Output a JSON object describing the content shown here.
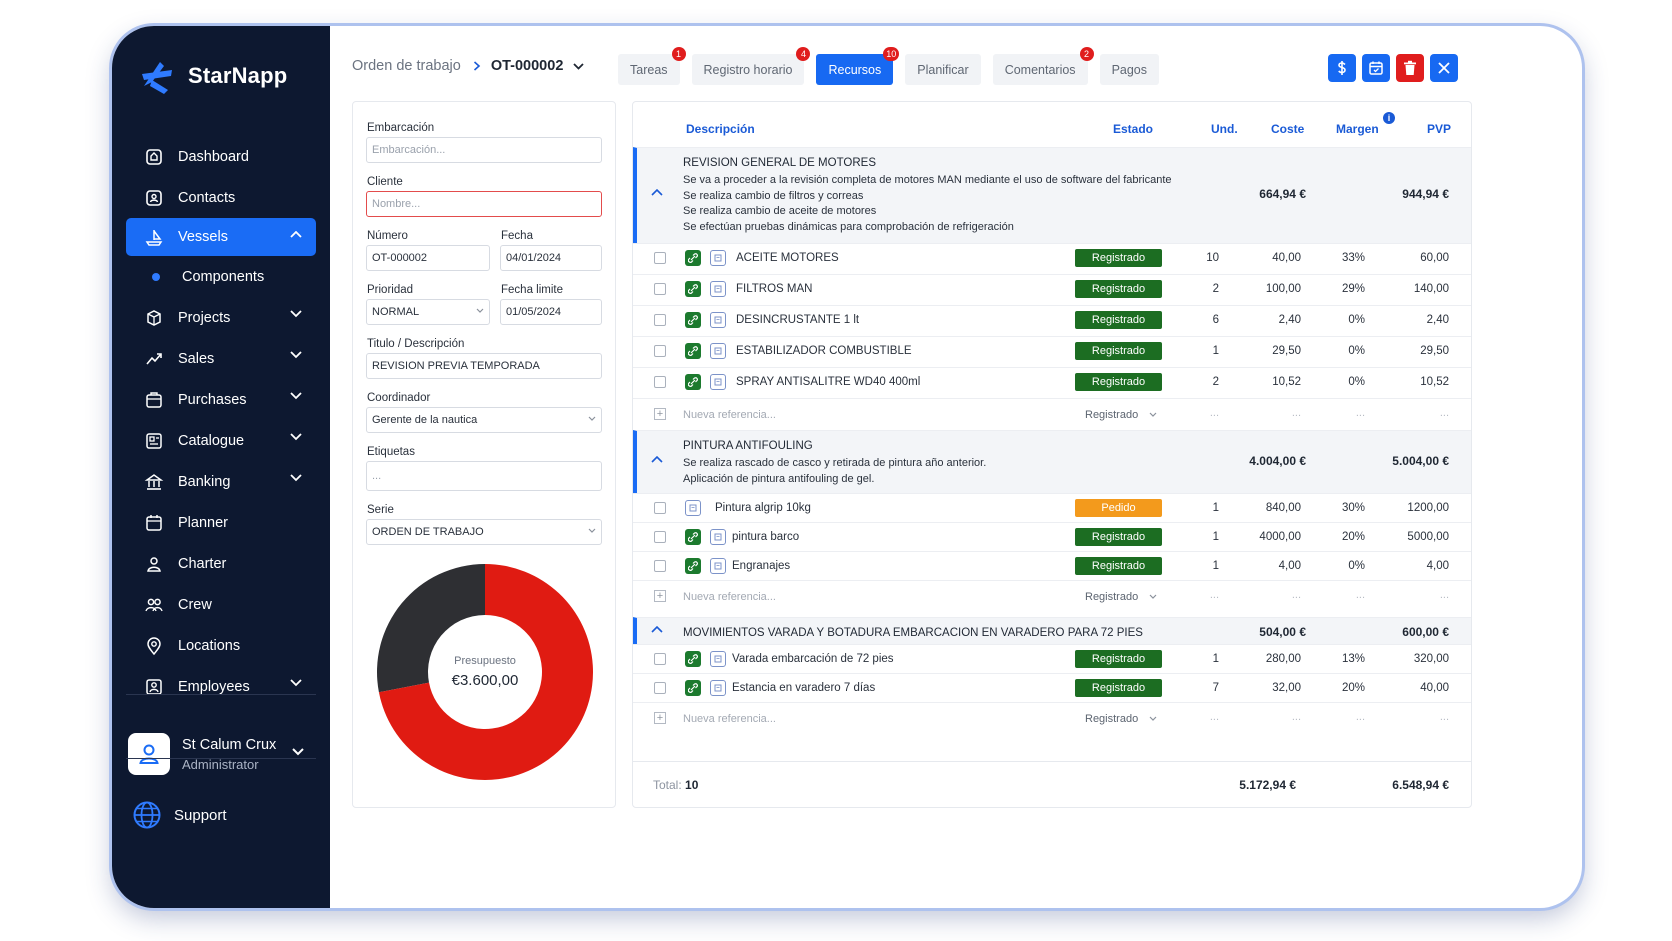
{
  "app": {
    "name": "StarNapp"
  },
  "sidebar": {
    "items": [
      {
        "label": "Dashboard",
        "icon": "dashboard-icon",
        "chevron": false
      },
      {
        "label": "Contacts",
        "icon": "contacts-icon",
        "chevron": false
      },
      {
        "label": "Vessels",
        "icon": "vessels-icon",
        "chevron": true,
        "active": true,
        "expanded": true
      },
      {
        "label": "Components",
        "icon": "dot-icon",
        "sub": true
      },
      {
        "label": "Projects",
        "icon": "projects-icon",
        "chevron": true
      },
      {
        "label": "Sales",
        "icon": "sales-icon",
        "chevron": true
      },
      {
        "label": "Purchases",
        "icon": "purchases-icon",
        "chevron": true
      },
      {
        "label": "Catalogue",
        "icon": "catalogue-icon",
        "chevron": true
      },
      {
        "label": "Banking",
        "icon": "banking-icon",
        "chevron": true
      },
      {
        "label": "Planner",
        "icon": "planner-icon",
        "chevron": false
      },
      {
        "label": "Charter",
        "icon": "charter-icon",
        "chevron": false
      },
      {
        "label": "Crew",
        "icon": "crew-icon",
        "chevron": false
      },
      {
        "label": "Locations",
        "icon": "locations-icon",
        "chevron": false
      },
      {
        "label": "Employees",
        "icon": "employees-icon",
        "chevron": true
      }
    ],
    "user": {
      "name": "St Calum Crux",
      "role": "Administrator"
    },
    "support": "Support"
  },
  "header": {
    "breadcrumb_root": "Orden de trabajo",
    "breadcrumb_current": "OT-000002",
    "tabs": [
      {
        "label": "Tareas",
        "badge": "1"
      },
      {
        "label": "Registro horario",
        "badge": "4"
      },
      {
        "label": "Recursos",
        "badge": "10",
        "active": true
      },
      {
        "label": "Planificar",
        "badge": ""
      },
      {
        "label": "Comentarios",
        "badge": "2"
      },
      {
        "label": "Pagos",
        "badge": ""
      }
    ],
    "colors": {
      "accent": "#1769f2",
      "danger": "#e01d1d"
    }
  },
  "form": {
    "embarcacion_label": "Embarcación",
    "embarcacion_placeholder": "Embarcación...",
    "cliente_label": "Cliente",
    "cliente_placeholder": "Nombre...",
    "numero_label": "Número",
    "numero_value": "OT-000002",
    "fecha_label": "Fecha",
    "fecha_value": "04/01/2024",
    "prioridad_label": "Prioridad",
    "prioridad_value": "NORMAL",
    "fecha_limite_label": "Fecha limite",
    "fecha_limite_value": "01/05/2024",
    "titulo_label": "Titulo / Descripción",
    "titulo_value": "REVISION PREVIA TEMPORADA",
    "coordinador_label": "Coordinador",
    "coordinador_value": "Gerente de la nautica",
    "etiquetas_label": "Etiquetas",
    "etiquetas_placeholder": "...",
    "serie_label": "Serie",
    "serie_value": "ORDEN DE TRABAJO",
    "budget_label": "Presupuesto",
    "budget_value": "€3.600,00",
    "budget_share": 0.72,
    "budget_colors": {
      "main": "#e01b12",
      "rest": "#2e2f33"
    }
  },
  "table": {
    "headers": {
      "descripcion": "Descripción",
      "estado": "Estado",
      "und": "Und.",
      "coste": "Coste",
      "margen": "Margen",
      "pvp": "PVP"
    },
    "new_ref_placeholder": "Nueva referencia...",
    "new_ref_status": "Registrado",
    "empty": "...",
    "groups": [
      {
        "title": "REVISION GENERAL DE MOTORES",
        "desc": [
          "Se va a proceder a la revisión completa de motores MAN mediante el uso de software del fabricante",
          "Se realiza cambio de filtros y correas",
          "Se realiza cambio de aceite de motores",
          "Se efectúan pruebas dinámicas para comprobación de refrigeración"
        ],
        "coste": "664,94 €",
        "pvp": "944,94 €",
        "items": [
          {
            "name": "ACEITE MOTORES",
            "status": "Registrado",
            "und": "10",
            "coste": "40,00",
            "margen": "33%",
            "pvp": "60,00",
            "green": true
          },
          {
            "name": "FILTROS MAN",
            "status": "Registrado",
            "und": "2",
            "coste": "100,00",
            "margen": "29%",
            "pvp": "140,00",
            "green": true
          },
          {
            "name": "DESINCRUSTANTE 1 lt",
            "status": "Registrado",
            "und": "6",
            "coste": "2,40",
            "margen": "0%",
            "pvp": "2,40",
            "green": true
          },
          {
            "name": "ESTABILIZADOR COMBUSTIBLE",
            "status": "Registrado",
            "und": "1",
            "coste": "29,50",
            "margen": "0%",
            "pvp": "29,50",
            "green": true
          },
          {
            "name": "SPRAY ANTISALITRE WD40 400ml",
            "status": "Registrado",
            "und": "2",
            "coste": "10,52",
            "margen": "0%",
            "pvp": "10,52",
            "green": true
          }
        ]
      },
      {
        "title": "PINTURA ANTIFOULING",
        "desc": [
          "Se realiza rascado de casco y retirada de pintura año anterior.",
          "Aplicación de pintura antifouling de gel."
        ],
        "coste": "4.004,00 €",
        "pvp": "5.004,00 €",
        "items": [
          {
            "name": "Pintura algrip 10kg",
            "status": "Pedido",
            "und": "1",
            "coste": "840,00",
            "margen": "30%",
            "pvp": "1200,00",
            "green": false
          },
          {
            "name": "pintura barco",
            "status": "Registrado",
            "und": "1",
            "coste": "4000,00",
            "margen": "20%",
            "pvp": "5000,00",
            "green": true
          },
          {
            "name": "Engranajes",
            "status": "Registrado",
            "und": "1",
            "coste": "4,00",
            "margen": "0%",
            "pvp": "4,00",
            "green": true
          }
        ]
      },
      {
        "title": "MOVIMIENTOS VARADA Y BOTADURA EMBARCACION EN VARADERO PARA 72 PIES",
        "desc": [],
        "coste": "504,00 €",
        "pvp": "600,00 €",
        "items": [
          {
            "name": "Varada embarcación de 72 pies",
            "status": "Registrado",
            "und": "1",
            "coste": "280,00",
            "margen": "13%",
            "pvp": "320,00",
            "green": true
          },
          {
            "name": "Estancia en varadero 7 días",
            "status": "Registrado",
            "und": "7",
            "coste": "32,00",
            "margen": "20%",
            "pvp": "40,00",
            "green": true
          }
        ]
      }
    ],
    "total_label": "Total:",
    "total_count": "10",
    "total_coste": "5.172,94 €",
    "total_pvp": "6.548,94 €",
    "colors": {
      "registrado": "#1c6d22",
      "pedido": "#f39a1c",
      "header_text": "#1a5ad6"
    }
  }
}
